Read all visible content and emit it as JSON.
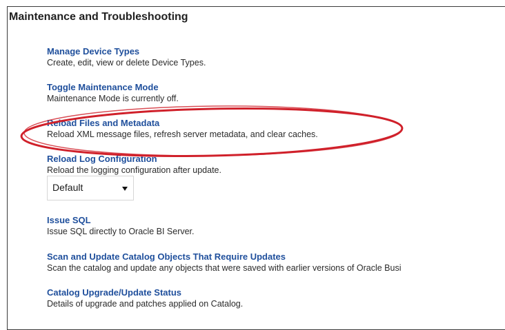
{
  "section": {
    "title": "Maintenance and Troubleshooting"
  },
  "items": [
    {
      "link": "Manage Device Types",
      "description": "Create, edit, view or delete Device Types."
    },
    {
      "link": "Toggle Maintenance Mode",
      "description": "Maintenance Mode is currently off."
    },
    {
      "link": "Reload Files and Metadata",
      "description": "Reload XML message files, refresh server metadata, and clear caches."
    },
    {
      "link": "Reload Log Configuration",
      "description": "Reload the logging configuration after update."
    },
    {
      "link": "Issue SQL",
      "description": "Issue SQL directly to Oracle BI Server."
    },
    {
      "link": "Scan and Update Catalog Objects That Require Updates",
      "description": "Scan the catalog and update any objects that were saved with earlier versions of Oracle Busi"
    },
    {
      "link": "Catalog Upgrade/Update Status",
      "description": "Details of upgrade and patches applied on Catalog."
    }
  ],
  "log_level_select": {
    "value": "Default"
  },
  "colors": {
    "link": "#1f4f9c",
    "highlight_ellipse": "#d0202a",
    "panel_border": "#3a3a3a"
  }
}
